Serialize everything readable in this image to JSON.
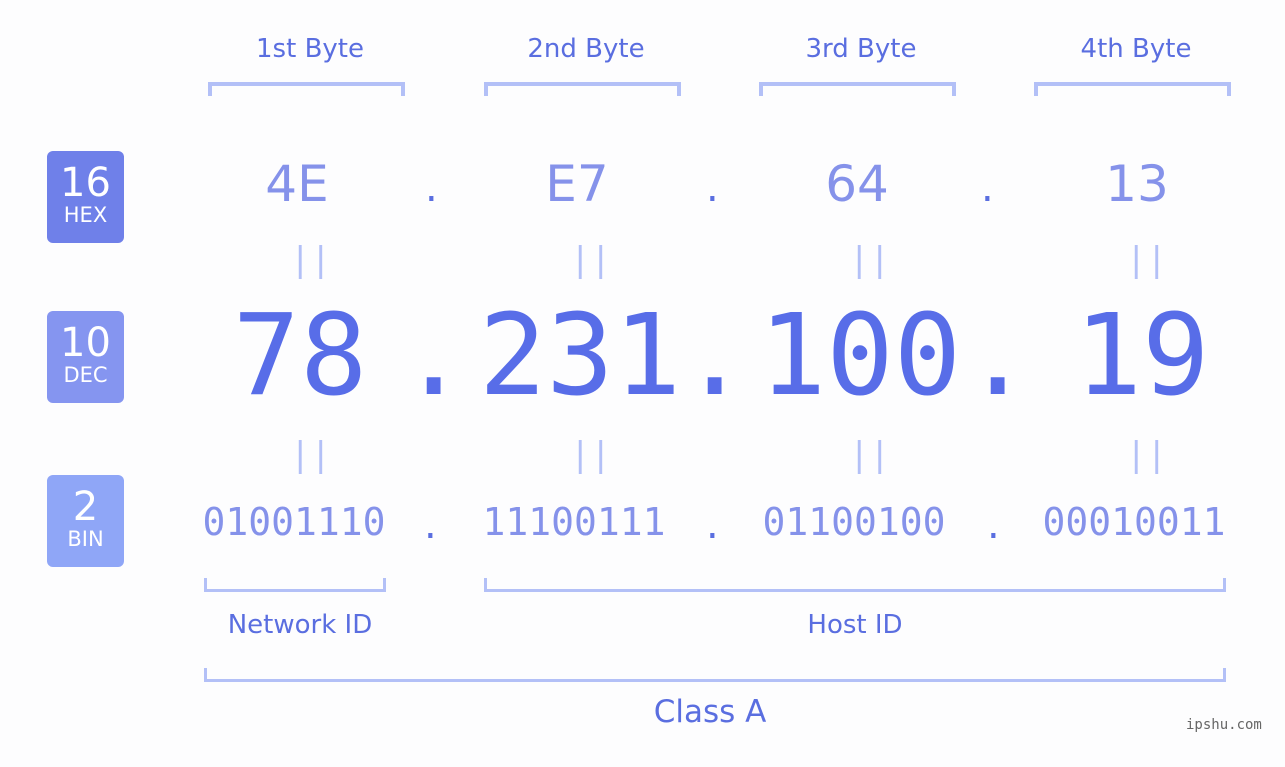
{
  "badges": [
    {
      "number": "16",
      "label": "HEX",
      "color": "#6f80e9"
    },
    {
      "number": "10",
      "label": "DEC",
      "color": "#8595f0"
    },
    {
      "number": "2",
      "label": "BIN",
      "color": "#8fa6f7"
    }
  ],
  "bytes": [
    {
      "label": "1st Byte",
      "hex": "4E",
      "dec": "78",
      "bin": "01001110"
    },
    {
      "label": "2nd Byte",
      "hex": "E7",
      "dec": "231",
      "bin": "11100111"
    },
    {
      "label": "3rd Byte",
      "hex": "64",
      "dec": "100",
      "bin": "01100100"
    },
    {
      "label": "4th Byte",
      "hex": "13",
      "dec": "19",
      "bin": "00010011"
    }
  ],
  "separator": ".",
  "equals": "||",
  "network_id_label": "Network ID",
  "host_id_label": "Host ID",
  "class_label": "Class A",
  "watermark": "ipshu.com",
  "colors": {
    "text": "#5a6ee0",
    "value_light": "#8592ea",
    "bracket": "#b3c0f7"
  }
}
